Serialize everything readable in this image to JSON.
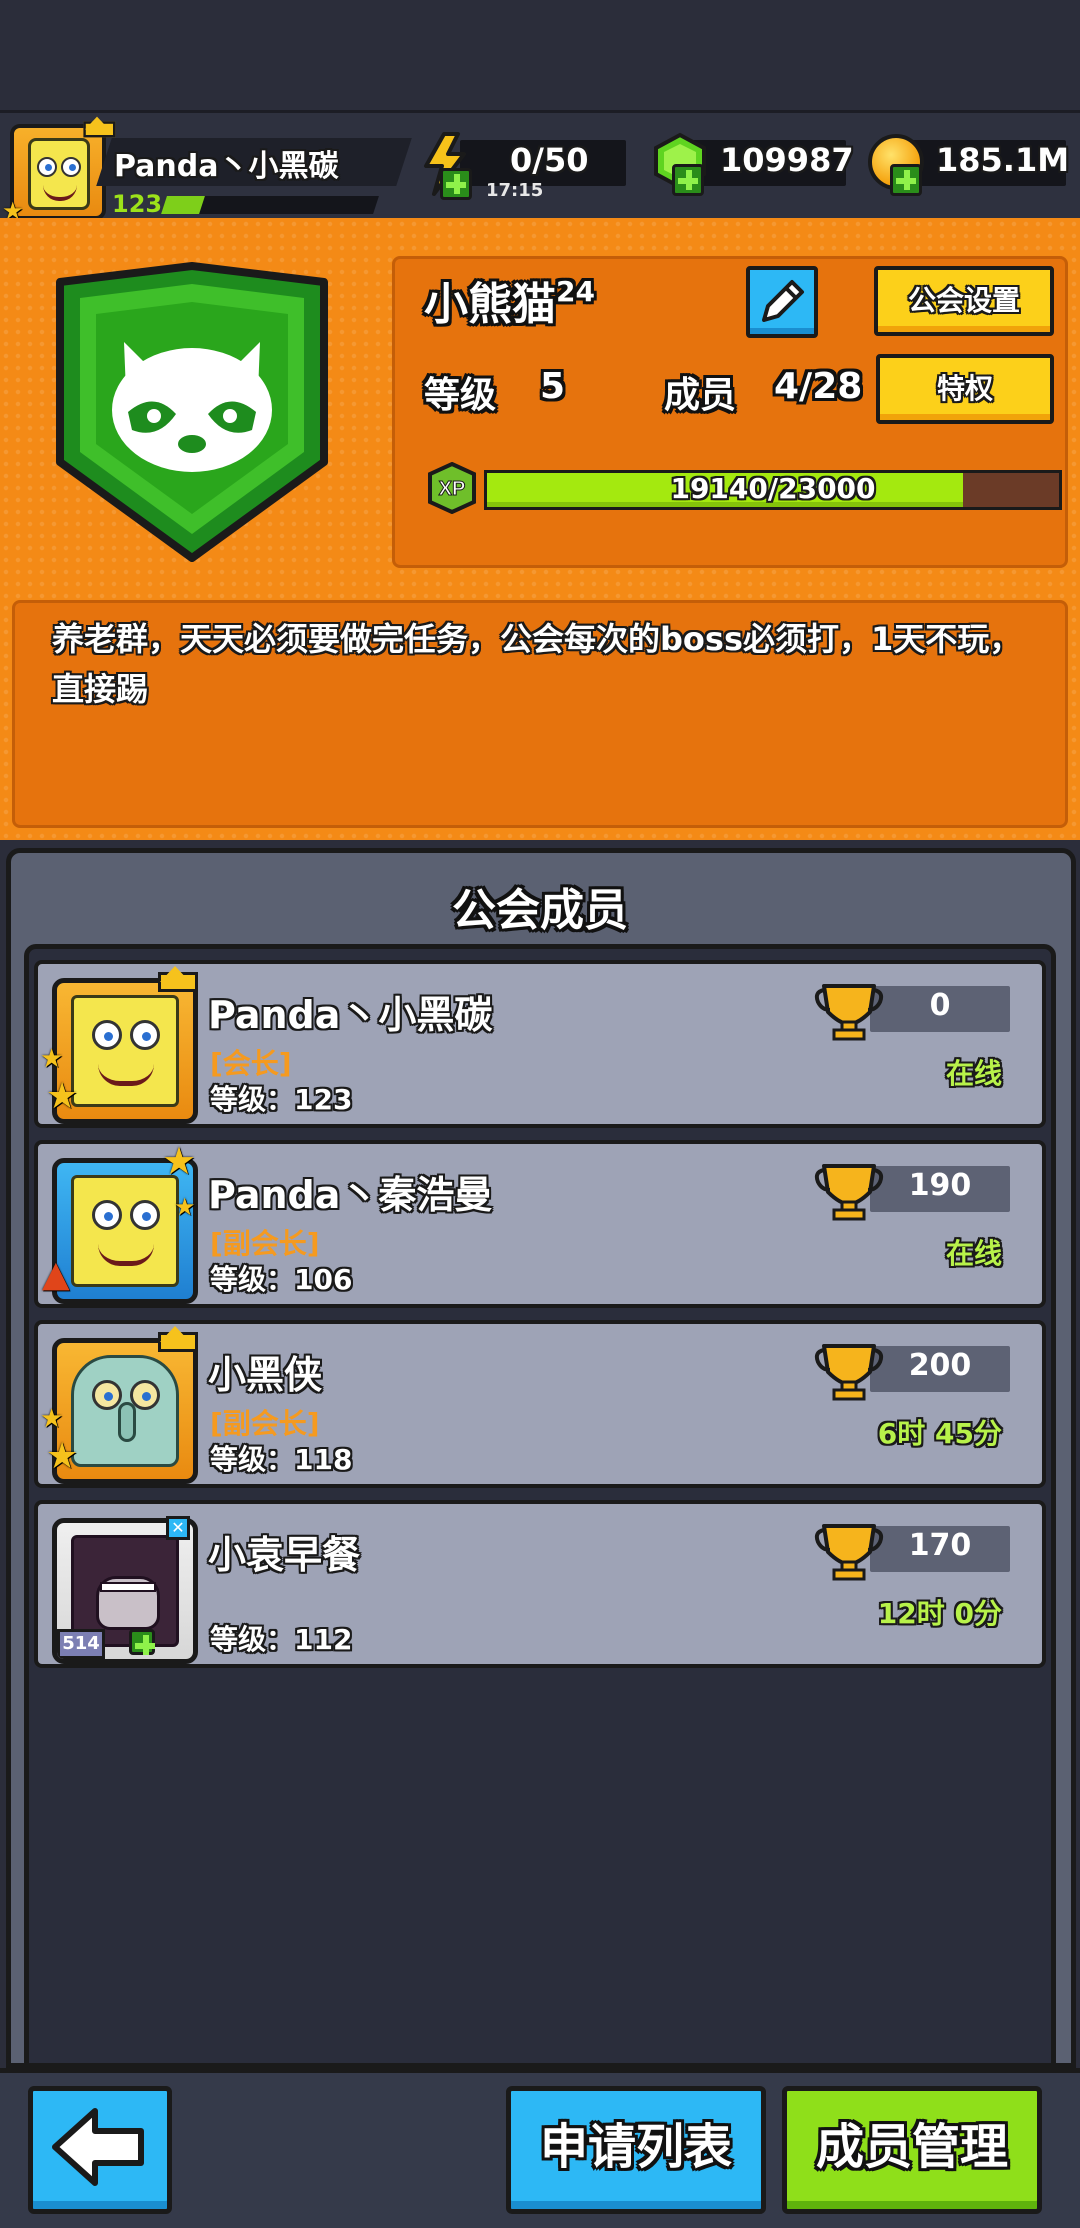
{
  "player": {
    "name": "Panda丶小黑碳",
    "level": "123",
    "xp_fraction": 0.18
  },
  "resources": {
    "energy": "0/50",
    "energy_timer": "17:15",
    "gems": "109987",
    "coins": "185.1M"
  },
  "guild": {
    "name": "小熊猫",
    "name_superscript": "24",
    "settings_label": "公会设置",
    "privilege_label": "特权",
    "level_label": "等级",
    "level_value": "5",
    "members_label": "成员",
    "members_value": "4/28",
    "xp_icon_label": "XP",
    "xp_text": "19140/23000",
    "xp_current": 19140,
    "xp_max": 23000,
    "description": "养老群，天天必须要做完任务，公会每次的boss必须打，1天不玩，直接踢"
  },
  "members_panel": {
    "title": "公会成员",
    "members": [
      {
        "name": "Panda丶小黑碳",
        "role": "[会长]",
        "level": "等级：123",
        "score": "0",
        "status": "在线"
      },
      {
        "name": "Panda丶秦浩曼",
        "role": "[副会长]",
        "level": "等级：106",
        "score": "190",
        "status": "在线"
      },
      {
        "name": "小黑侠",
        "role": "[副会长]",
        "level": "等级：118",
        "score": "200",
        "status": "6时 45分"
      },
      {
        "name": "小袁早餐",
        "role": "",
        "level": "等级：112",
        "score": "170",
        "status": "12时 0分",
        "badge": "514"
      }
    ]
  },
  "bottom": {
    "apply_list_label": "申请列表",
    "member_manage_label": "成员管理"
  },
  "colors": {
    "orange_bg": "#f48a16",
    "online_green": "#b8f24a",
    "role_orange": "#f59a1f",
    "button_blue": "#2db8f5",
    "button_green": "#8fdf1a",
    "button_yellow": "#fcd01a"
  }
}
